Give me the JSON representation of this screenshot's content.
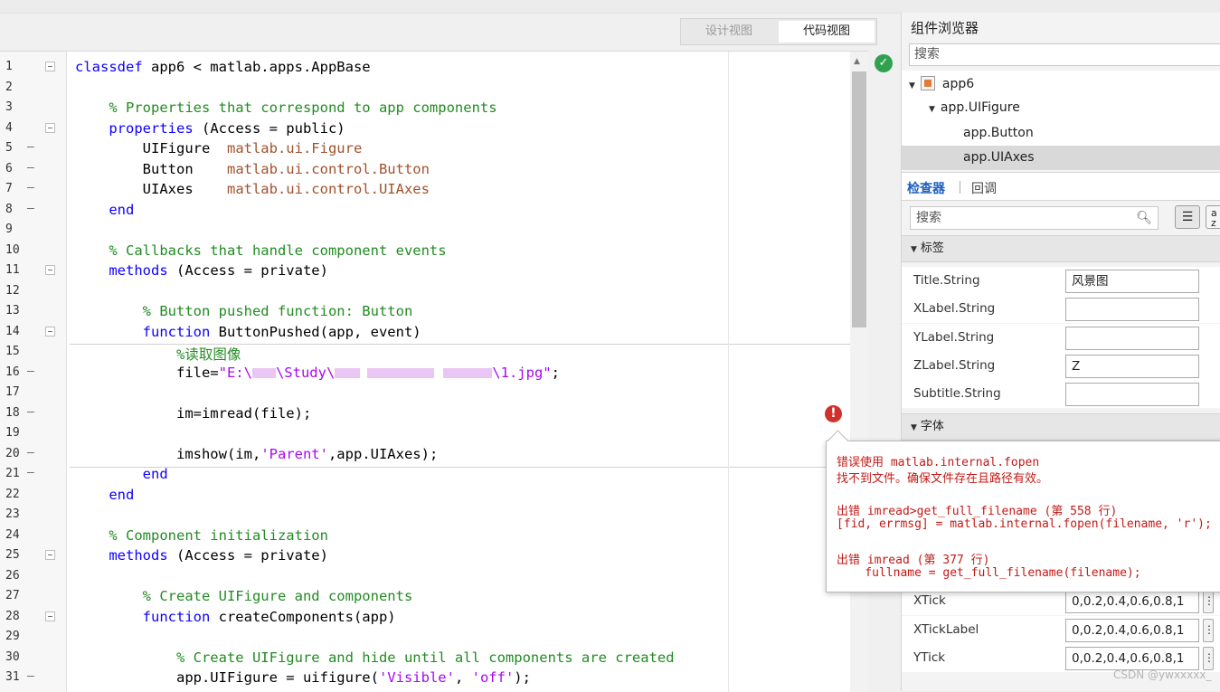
{
  "view_toggle": {
    "design": "设计视图",
    "code": "代码视图"
  },
  "editor": {
    "lines": [
      {
        "n": "1",
        "dash": false,
        "fold": true,
        "tokens": [
          {
            "t": "kw",
            "v": "classdef"
          },
          {
            "t": "p",
            "v": " app6 < matlab.apps.AppBase"
          }
        ]
      },
      {
        "n": "2",
        "dash": false,
        "fold": false,
        "tokens": []
      },
      {
        "n": "3",
        "dash": false,
        "fold": false,
        "tokens": [
          {
            "t": "p",
            "v": "    "
          },
          {
            "t": "cm",
            "v": "% Properties that correspond to app components"
          }
        ]
      },
      {
        "n": "4",
        "dash": false,
        "fold": true,
        "tokens": [
          {
            "t": "p",
            "v": "    "
          },
          {
            "t": "kw",
            "v": "properties"
          },
          {
            "t": "p",
            "v": " (Access = public)"
          }
        ]
      },
      {
        "n": "5",
        "dash": true,
        "fold": false,
        "tokens": [
          {
            "t": "p",
            "v": "        UIFigure  "
          },
          {
            "t": "ty",
            "v": "matlab.ui.Figure"
          }
        ]
      },
      {
        "n": "6",
        "dash": true,
        "fold": false,
        "tokens": [
          {
            "t": "p",
            "v": "        Button    "
          },
          {
            "t": "ty",
            "v": "matlab.ui.control.Button"
          }
        ]
      },
      {
        "n": "7",
        "dash": true,
        "fold": false,
        "tokens": [
          {
            "t": "p",
            "v": "        UIAxes    "
          },
          {
            "t": "ty",
            "v": "matlab.ui.control.UIAxes"
          }
        ]
      },
      {
        "n": "8",
        "dash": true,
        "fold": false,
        "tokens": [
          {
            "t": "p",
            "v": "    "
          },
          {
            "t": "kw",
            "v": "end"
          }
        ]
      },
      {
        "n": "9",
        "dash": false,
        "fold": false,
        "tokens": []
      },
      {
        "n": "10",
        "dash": false,
        "fold": false,
        "tokens": [
          {
            "t": "p",
            "v": "    "
          },
          {
            "t": "cm",
            "v": "% Callbacks that handle component events"
          }
        ]
      },
      {
        "n": "11",
        "dash": false,
        "fold": true,
        "tokens": [
          {
            "t": "p",
            "v": "    "
          },
          {
            "t": "kw",
            "v": "methods"
          },
          {
            "t": "p",
            "v": " (Access = private)"
          }
        ]
      },
      {
        "n": "12",
        "dash": false,
        "fold": false,
        "tokens": []
      },
      {
        "n": "13",
        "dash": false,
        "fold": false,
        "tokens": [
          {
            "t": "p",
            "v": "        "
          },
          {
            "t": "cm",
            "v": "% Button pushed function: Button"
          }
        ]
      },
      {
        "n": "14",
        "dash": false,
        "fold": true,
        "tokens": [
          {
            "t": "p",
            "v": "        "
          },
          {
            "t": "kw",
            "v": "function"
          },
          {
            "t": "p",
            "v": " ButtonPushed(app, event)"
          }
        ]
      },
      {
        "n": "15",
        "dash": false,
        "fold": false,
        "tokens": [
          {
            "t": "p",
            "v": "            "
          },
          {
            "t": "cm",
            "v": "%读取图像"
          }
        ]
      },
      {
        "n": "16",
        "dash": true,
        "fold": false,
        "tokens": [
          {
            "t": "p",
            "v": "            file="
          },
          {
            "t": "st",
            "v": "\"E:\\"
          },
          {
            "t": "blur",
            "w": 26
          },
          {
            "t": "st",
            "v": "\\Study\\"
          },
          {
            "t": "blur",
            "w": 28
          },
          {
            "t": "gap",
            "w": 8
          },
          {
            "t": "blur",
            "w": 74
          },
          {
            "t": "gap",
            "w": 10
          },
          {
            "t": "blur",
            "w": 54
          },
          {
            "t": "st",
            "v": "\\1.jpg\""
          },
          {
            "t": "p",
            "v": ";"
          }
        ]
      },
      {
        "n": "17",
        "dash": false,
        "fold": false,
        "tokens": []
      },
      {
        "n": "18",
        "dash": true,
        "fold": false,
        "tokens": [
          {
            "t": "p",
            "v": "            im=imread(file);"
          }
        ]
      },
      {
        "n": "19",
        "dash": false,
        "fold": false,
        "tokens": []
      },
      {
        "n": "20",
        "dash": true,
        "fold": false,
        "tokens": [
          {
            "t": "p",
            "v": "            imshow(im,"
          },
          {
            "t": "st",
            "v": "'Parent'"
          },
          {
            "t": "p",
            "v": ",app.UIAxes);"
          }
        ]
      },
      {
        "n": "21",
        "dash": true,
        "fold": false,
        "tokens": [
          {
            "t": "p",
            "v": "        "
          },
          {
            "t": "kw",
            "v": "end"
          }
        ]
      },
      {
        "n": "22",
        "dash": false,
        "fold": false,
        "tokens": [
          {
            "t": "p",
            "v": "    "
          },
          {
            "t": "kw",
            "v": "end"
          }
        ]
      },
      {
        "n": "23",
        "dash": false,
        "fold": false,
        "tokens": []
      },
      {
        "n": "24",
        "dash": false,
        "fold": false,
        "tokens": [
          {
            "t": "p",
            "v": "    "
          },
          {
            "t": "cm",
            "v": "% Component initialization"
          }
        ]
      },
      {
        "n": "25",
        "dash": false,
        "fold": true,
        "tokens": [
          {
            "t": "p",
            "v": "    "
          },
          {
            "t": "kw",
            "v": "methods"
          },
          {
            "t": "p",
            "v": " (Access = private)"
          }
        ]
      },
      {
        "n": "26",
        "dash": false,
        "fold": false,
        "tokens": []
      },
      {
        "n": "27",
        "dash": false,
        "fold": false,
        "tokens": [
          {
            "t": "p",
            "v": "        "
          },
          {
            "t": "cm",
            "v": "% Create UIFigure and components"
          }
        ]
      },
      {
        "n": "28",
        "dash": false,
        "fold": true,
        "tokens": [
          {
            "t": "p",
            "v": "        "
          },
          {
            "t": "kw",
            "v": "function"
          },
          {
            "t": "p",
            "v": " createComponents(app)"
          }
        ]
      },
      {
        "n": "29",
        "dash": false,
        "fold": false,
        "tokens": []
      },
      {
        "n": "30",
        "dash": false,
        "fold": false,
        "tokens": [
          {
            "t": "p",
            "v": "            "
          },
          {
            "t": "cm",
            "v": "% Create UIFigure and hide until all components are created"
          }
        ]
      },
      {
        "n": "31",
        "dash": true,
        "fold": false,
        "tokens": [
          {
            "t": "p",
            "v": "            app.UIFigure = uifigure("
          },
          {
            "t": "st",
            "v": "'Visible'"
          },
          {
            "t": "p",
            "v": ", "
          },
          {
            "t": "st",
            "v": "'off'"
          },
          {
            "t": "p",
            "v": ");"
          }
        ]
      }
    ]
  },
  "error_tooltip": {
    "lines": [
      "错误使用 matlab.internal.fopen",
      "找不到文件。确保文件存在且路径有效。",
      "",
      "出错 imread>get_full_filename (第 558 行)",
      "[fid, errmsg] = matlab.internal.fopen(filename, 'r');",
      "",
      "出错 imread (第 377 行)",
      "    fullname = get_full_filename(filename);"
    ]
  },
  "component_browser": {
    "title": "组件浏览器",
    "search_placeholder": "搜索",
    "tree": [
      {
        "label": "app6",
        "level": 0,
        "selected": false
      },
      {
        "label": "app.UIFigure",
        "level": 1,
        "selected": false
      },
      {
        "label": "app.Button",
        "level": 2,
        "selected": false
      },
      {
        "label": "app.UIAxes",
        "level": 2,
        "selected": true
      }
    ]
  },
  "inspector": {
    "tab_inspector": "检查器",
    "tab_callbacks": "回调",
    "search_placeholder": "搜索",
    "sort_z_label": "a\nz",
    "section_labels": "标签",
    "section_font": "字体",
    "label_props": [
      {
        "name": "Title.String",
        "value": "风景图"
      },
      {
        "name": "XLabel.String",
        "value": ""
      },
      {
        "name": "YLabel.String",
        "value": ""
      },
      {
        "name": "ZLabel.String",
        "value": "Z"
      },
      {
        "name": "Subtitle.String",
        "value": ""
      }
    ],
    "tick_props": [
      {
        "name": "XTick",
        "value": "0,0.2,0.4,0.6,0.8,1"
      },
      {
        "name": "XTickLabel",
        "value": "0,0.2,0.4,0.6,0.8,1"
      },
      {
        "name": "YTick",
        "value": "0,0.2,0.4,0.6,0.8,1"
      }
    ]
  },
  "watermark": "CSDN @ywxxxxx_"
}
